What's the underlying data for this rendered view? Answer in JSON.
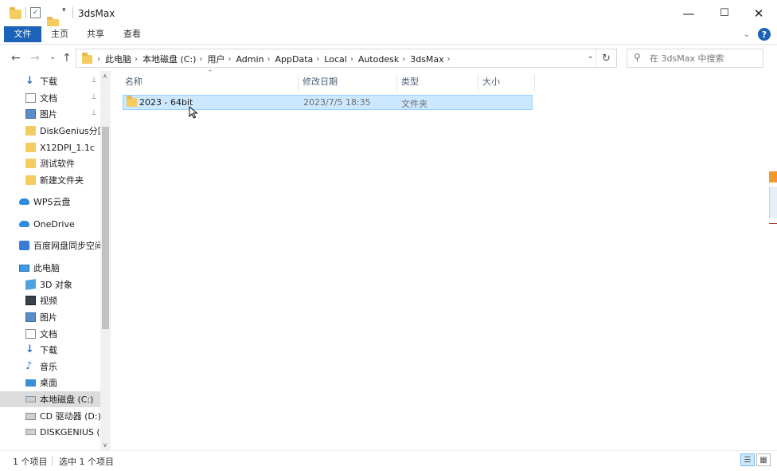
{
  "window": {
    "title": "3dsMax",
    "minimize": "—",
    "maximize": "☐",
    "close": "✕"
  },
  "ribbon": {
    "tabs": [
      "文件",
      "主页",
      "共享",
      "查看"
    ],
    "help": "?"
  },
  "nav": {
    "back": "←",
    "forward": "→",
    "recent": "⌄",
    "up": "↑"
  },
  "address": {
    "crumbs": [
      "此电脑",
      "本地磁盘 (C:)",
      "用户",
      "Admin",
      "AppData",
      "Local",
      "Autodesk",
      "3dsMax"
    ]
  },
  "search": {
    "placeholder": "在 3dsMax 中搜索"
  },
  "sidebar": {
    "items": [
      {
        "label": "下载",
        "icon": "download-icon",
        "pinned": true
      },
      {
        "label": "文档",
        "icon": "document-icon",
        "pinned": true
      },
      {
        "label": "图片",
        "icon": "picture-icon",
        "pinned": true
      },
      {
        "label": "DiskGenius分区",
        "icon": "folder-icon",
        "pinned": false
      },
      {
        "label": "X12DPI_1.1c",
        "icon": "folder-icon",
        "pinned": false
      },
      {
        "label": "测试软件",
        "icon": "folder-icon",
        "pinned": false
      },
      {
        "label": "新建文件夹",
        "icon": "folder-icon",
        "pinned": false
      },
      {
        "label": "WPS云盘",
        "icon": "wps-cloud-icon",
        "pinned": false
      },
      {
        "label": "OneDrive",
        "icon": "onedrive-icon",
        "pinned": false
      },
      {
        "label": "百度网盘同步空间",
        "icon": "baidu-netdisk-icon",
        "pinned": false
      },
      {
        "label": "此电脑",
        "icon": "this-pc-icon",
        "pinned": false
      },
      {
        "label": "3D 对象",
        "icon": "3d-objects-icon",
        "pinned": false
      },
      {
        "label": "视频",
        "icon": "video-icon",
        "pinned": false
      },
      {
        "label": "图片",
        "icon": "picture-icon",
        "pinned": false
      },
      {
        "label": "文档",
        "icon": "document-icon",
        "pinned": false
      },
      {
        "label": "下载",
        "icon": "download-icon",
        "pinned": false
      },
      {
        "label": "音乐",
        "icon": "music-icon",
        "pinned": false
      },
      {
        "label": "桌面",
        "icon": "desktop-icon",
        "pinned": false
      },
      {
        "label": "本地磁盘 (C:)",
        "icon": "drive-icon",
        "pinned": false
      },
      {
        "label": "CD 驱动器 (D:)",
        "icon": "cd-drive-icon",
        "pinned": false
      },
      {
        "label": "DISKGENIUS (F",
        "icon": "usb-drive-icon",
        "pinned": false
      }
    ],
    "pin_glyph": "📌"
  },
  "columns": {
    "name": "名称",
    "date": "修改日期",
    "type": "类型",
    "size": "大小"
  },
  "files": [
    {
      "name": "2023 - 64bit",
      "date": "2023/7/5 18:35",
      "type": "文件夹",
      "size": ""
    }
  ],
  "status": {
    "count": "1 个项目",
    "selected": "选中 1 个项目"
  },
  "colors": {
    "accent": "#1b62b8",
    "selection": "#cce8ff",
    "folder": "#f3cd61"
  }
}
